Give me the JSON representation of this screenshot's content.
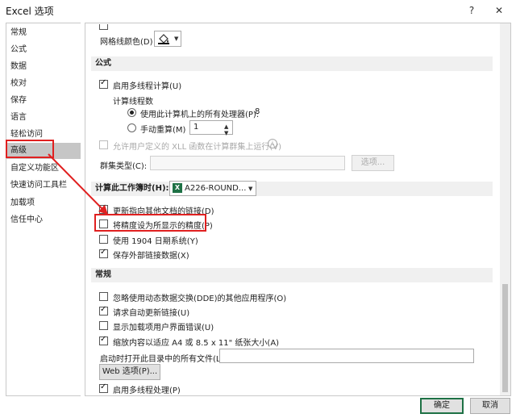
{
  "window": {
    "title": "Excel 选项",
    "help": "?",
    "close": "✕"
  },
  "sidebar": {
    "items": [
      {
        "label": "常规"
      },
      {
        "label": "公式"
      },
      {
        "label": "数据"
      },
      {
        "label": "校对"
      },
      {
        "label": "保存"
      },
      {
        "label": "语言"
      },
      {
        "label": "轻松访问"
      },
      {
        "label": "高级"
      },
      {
        "label": "自定义功能区"
      },
      {
        "label": "快速访问工具栏"
      },
      {
        "label": "加载项"
      },
      {
        "label": "信任中心"
      }
    ]
  },
  "display": {
    "gridline_color_label": "网格线颜色(D)"
  },
  "formulas": {
    "header": "公式",
    "multithread_label": "启用多线程计算(U)",
    "thread_count_label": "计算线程数",
    "use_all_label": "使用此计算机上的所有处理器(P):",
    "processor_count": "8",
    "manual_label": "手动重算(M)",
    "manual_value": "1",
    "xll_label": "允许用户定义的 XLL 函数在计算群集上运行(V)",
    "cluster_type_label": "群集类型(C):",
    "options_button": "选项..."
  },
  "workbook_calc": {
    "header": "计算此工作簿时(H):",
    "workbook_name": "A226-ROUND...",
    "update_links_label": "更新指向其他文档的链接(D)",
    "precision_label": "将精度设为所显示的精度(P)",
    "date1904_label": "使用 1904 日期系统(Y)",
    "save_external_label": "保存外部链接数据(X)"
  },
  "general": {
    "header": "常规",
    "dde_label": "忽略使用动态数据交换(DDE)的其他应用程序(O)",
    "auto_update_label": "请求自动更新链接(U)",
    "addin_errors_label": "显示加载项用户界面错误(U)",
    "scale_label": "缩放内容以适应 A4 或 8.5 x 11\" 纸张大小(A)",
    "startup_label": "启动时打开此目录中的所有文件(L):",
    "web_options_button": "Web 选项(P)...",
    "multithread_label": "启用多线程处理(P)"
  },
  "footer": {
    "ok": "确定",
    "cancel": "取消"
  },
  "colors": {
    "highlight": "#e02020",
    "excel_green": "#1e7145"
  }
}
